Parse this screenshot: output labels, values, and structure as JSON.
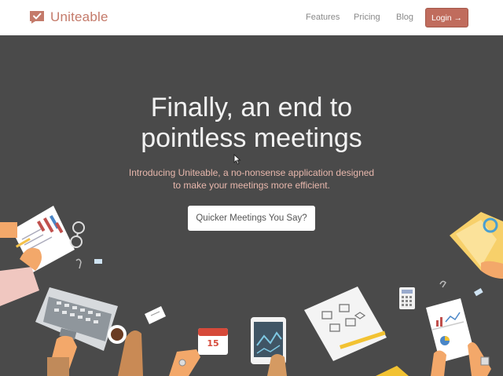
{
  "brand": {
    "name": "Uniteable"
  },
  "nav": {
    "features": "Features",
    "pricing": "Pricing",
    "blog": "Blog",
    "login": "Login →"
  },
  "hero": {
    "title_line1": "Finally, an end to",
    "title_line2": "pointless meetings",
    "subtitle_line1": "Introducing Uniteable, a no-nonsense application designed",
    "subtitle_line2": "to make your meetings more efficient.",
    "cta": "Quicker Meetings You Say?"
  },
  "illustration": {
    "calendar_day": "15"
  },
  "colors": {
    "accent": "#c06c5d",
    "background": "#4a4a4a",
    "brand_text": "#c47a6a"
  }
}
